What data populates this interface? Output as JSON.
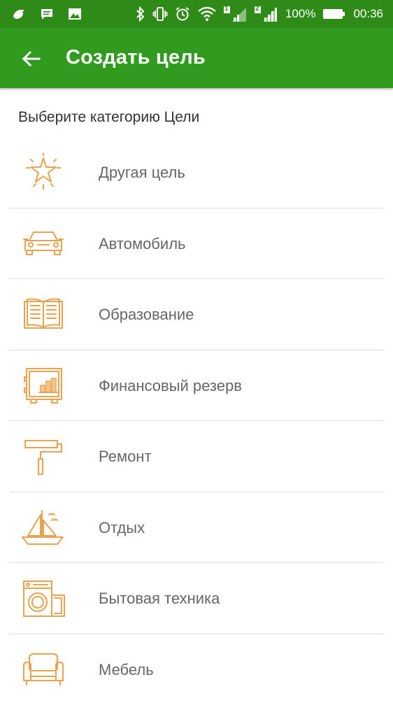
{
  "status_bar": {
    "battery_percent": "100%",
    "time": "00:36",
    "sim1": "1",
    "sim2": "2",
    "icons": [
      "bird-icon",
      "message-icon",
      "image-icon",
      "bluetooth-icon",
      "vibrate-icon",
      "alarm-icon",
      "wifi-icon",
      "signal-icon",
      "battery-icon"
    ]
  },
  "app_bar": {
    "title": "Создать цель",
    "back_icon": "arrow-left-icon",
    "color": "#319b1f"
  },
  "section_label": "Выберите категорию Цели",
  "categories": [
    {
      "label": "Другая цель",
      "icon": "star-icon"
    },
    {
      "label": "Автомобиль",
      "icon": "car-icon"
    },
    {
      "label": "Образование",
      "icon": "book-icon"
    },
    {
      "label": "Финансовый резерв",
      "icon": "safe-icon"
    },
    {
      "label": "Ремонт",
      "icon": "paint-roller-icon"
    },
    {
      "label": "Отдых",
      "icon": "sailboat-icon"
    },
    {
      "label": "Бытовая техника",
      "icon": "washing-machine-icon"
    },
    {
      "label": "Мебель",
      "icon": "armchair-icon"
    }
  ],
  "accent_color": "#eaa24c"
}
